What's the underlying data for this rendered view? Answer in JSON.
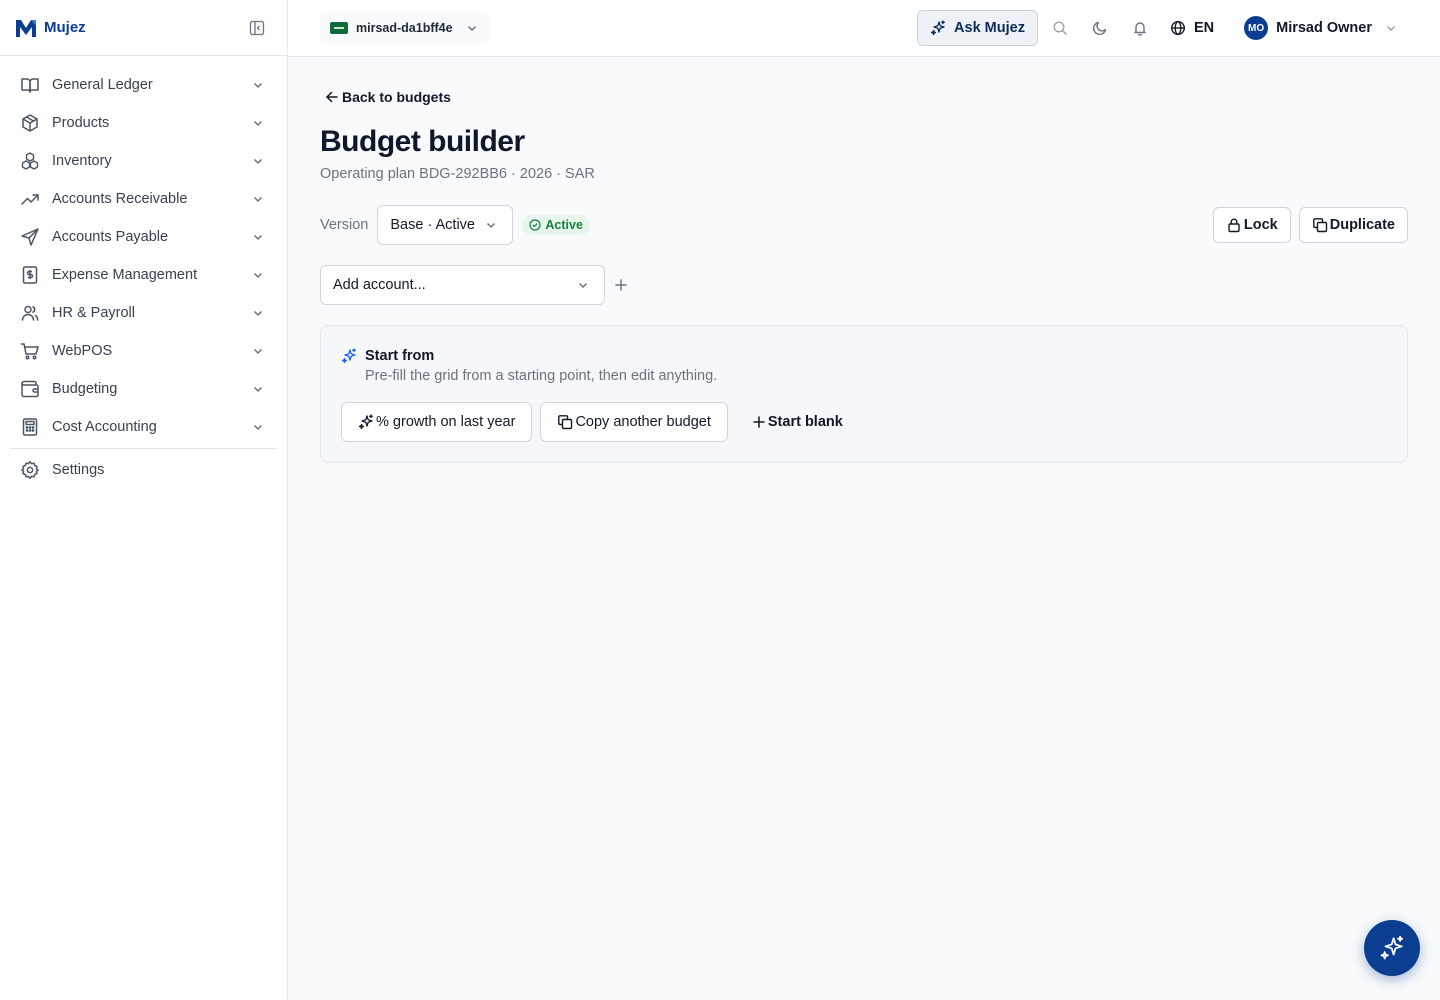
{
  "brand": {
    "name": "Mujez",
    "color": "#0b3d91"
  },
  "sidebar": {
    "items": [
      {
        "label": "General Ledger",
        "icon": "book-open-icon"
      },
      {
        "label": "Products",
        "icon": "package-icon"
      },
      {
        "label": "Inventory",
        "icon": "boxes-icon"
      },
      {
        "label": "Accounts Receivable",
        "icon": "trending-up-icon"
      },
      {
        "label": "Accounts Payable",
        "icon": "send-icon"
      },
      {
        "label": "Expense Management",
        "icon": "receipt-dollar-icon"
      },
      {
        "label": "HR & Payroll",
        "icon": "users-icon"
      },
      {
        "label": "WebPOS",
        "icon": "shopping-cart-icon"
      },
      {
        "label": "Budgeting",
        "icon": "wallet-icon"
      },
      {
        "label": "Cost Accounting",
        "icon": "calculator-icon"
      }
    ],
    "settings": {
      "label": "Settings",
      "icon": "gear-icon"
    }
  },
  "topbar": {
    "org_name": "mirsad-da1bff4e",
    "ask_label": "Ask Mujez",
    "language": "EN",
    "user": {
      "initials": "MO",
      "name": "Mirsad Owner"
    }
  },
  "page": {
    "back_label": "Back to budgets",
    "title": "Budget builder",
    "subtitle": "Operating plan BDG-292BB6 · 2026 · SAR",
    "version_label": "Version",
    "version_value": "Base · Active",
    "status_badge": "Active",
    "lock_label": "Lock",
    "duplicate_label": "Duplicate",
    "add_account_placeholder": "Add account..."
  },
  "start_from": {
    "title": "Start from",
    "description": "Pre-fill the grid from a starting point, then edit anything.",
    "options": {
      "growth": "% growth on last year",
      "copy": "Copy another budget",
      "blank": "Start blank"
    }
  },
  "colors": {
    "accent": "#0b3d91",
    "success_bg": "#e7f6ec",
    "success_text": "#15803d"
  }
}
